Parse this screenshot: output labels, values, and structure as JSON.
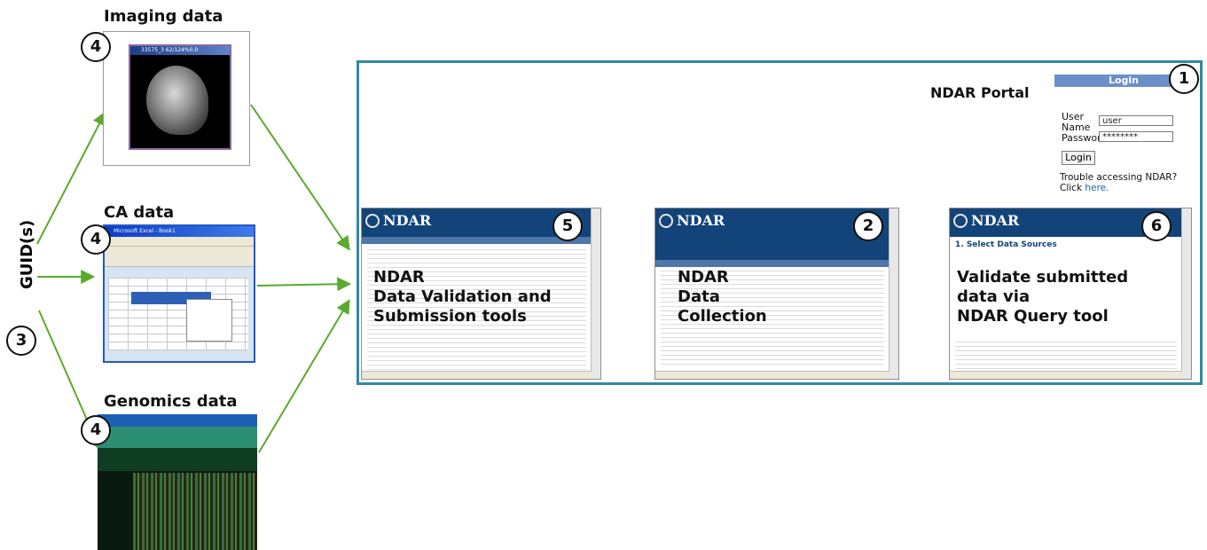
{
  "guid_label": "GUID(s)",
  "steps": {
    "guid": "3",
    "sources": "4",
    "portal_login": "1",
    "collection": "2",
    "submission": "5",
    "query": "6"
  },
  "sources": {
    "imaging": {
      "title": "Imaging data",
      "window_title": "33575_3 62/124%0.0"
    },
    "ca": {
      "title": "CA data",
      "window_title": "Microsoft Excel - Book1"
    },
    "genomics": {
      "title": "Genomics data"
    }
  },
  "portal": {
    "label": "NDAR Portal",
    "login": {
      "title": "Login",
      "user_name_label": "User Name",
      "user_value": "user",
      "password_label": "Password",
      "password_value": "********",
      "login_button": "Login",
      "trouble_text": "Trouble accessing NDAR? Click",
      "trouble_link": "here."
    },
    "screenshots": [
      {
        "brand": "NDAR",
        "caption": [
          "NDAR",
          "Data Validation and",
          "Submission tools"
        ]
      },
      {
        "brand": "NDAR",
        "caption": [
          "NDAR",
          "Data",
          "Collection"
        ]
      },
      {
        "brand": "NDAR",
        "caption": [
          "Validate submitted",
          "data via",
          "NDAR Query tool"
        ],
        "heading": "1. Select Data Sources"
      }
    ]
  },
  "colors": {
    "arrow": "#5aaa2c",
    "frame": "#2f8aa5",
    "ndar_header": "#12447a"
  }
}
